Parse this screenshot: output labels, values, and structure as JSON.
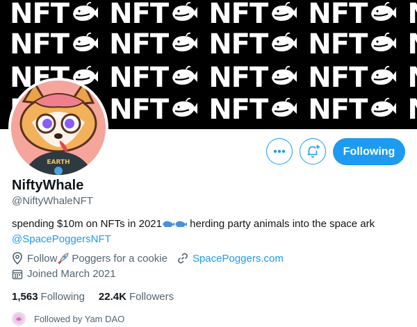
{
  "banner": {
    "tile_word": "NFT"
  },
  "profile": {
    "display_name": "NiftyWhale",
    "handle": "@NiftyWhaleNFT",
    "bio_part1": "spending $10m on NFTs in 2021",
    "bio_part2": " herding party animals into the space ark",
    "bio_mention": "@SpacePoggersNFT",
    "location_prefix": "Follow ",
    "location_suffix": "Poggers for a cookie",
    "website": "SpacePoggers.com",
    "joined": "Joined March 2021"
  },
  "actions": {
    "following_label": "Following",
    "more_icon": "more-icon",
    "notify_icon": "bell-plus-icon"
  },
  "stats": {
    "following_count": "1,563",
    "following_label": "Following",
    "followers_count": "22.4K",
    "followers_label": "Followers"
  },
  "followed_by": {
    "text": "Followed by Yam DAO"
  },
  "colors": {
    "accent": "#1d9bf0",
    "banner_bg": "#000000",
    "muted": "#536471"
  }
}
